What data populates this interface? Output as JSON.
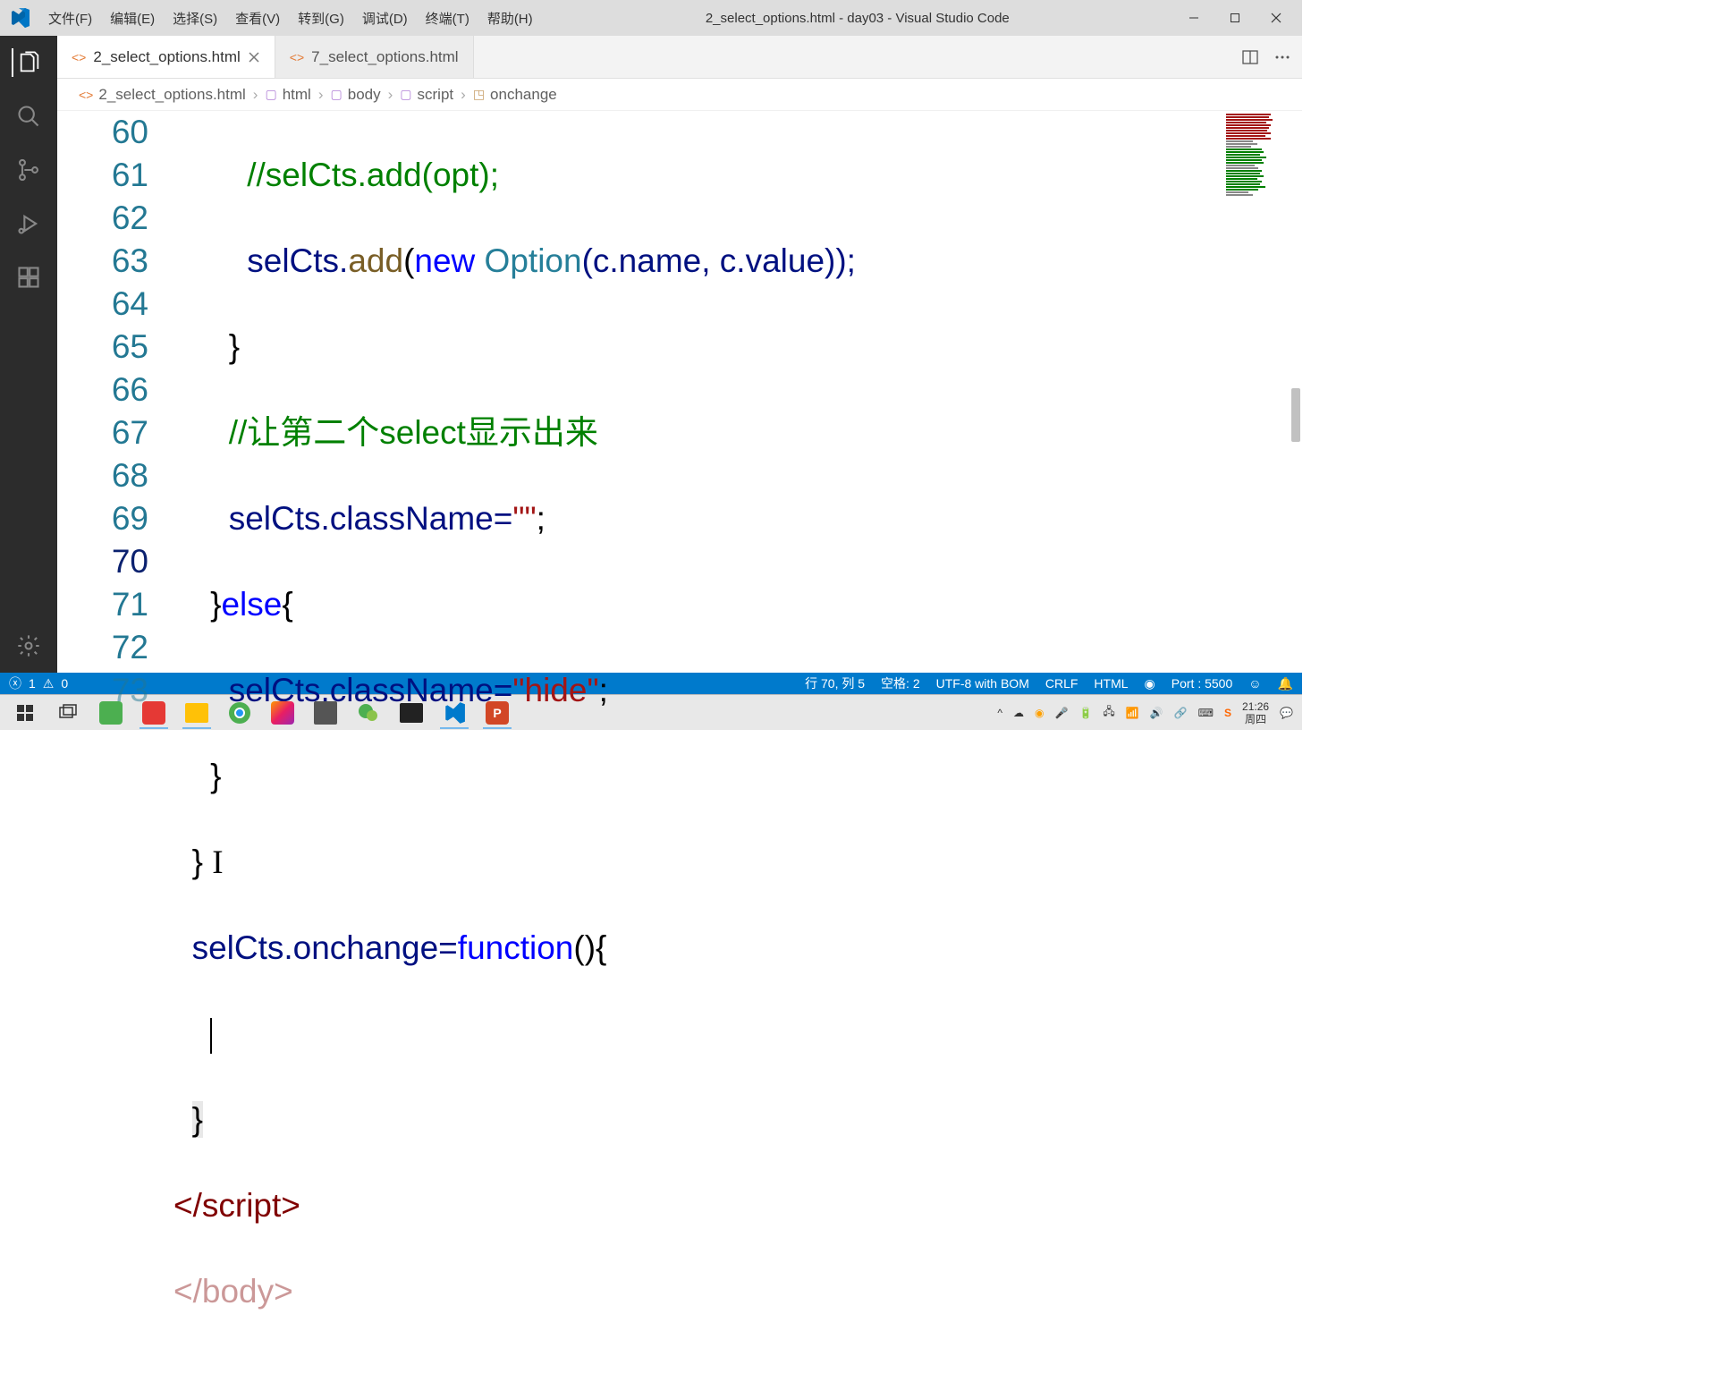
{
  "menu": {
    "file": "文件(F)",
    "edit": "编辑(E)",
    "selection": "选择(S)",
    "view": "查看(V)",
    "go": "转到(G)",
    "debug": "调试(D)",
    "terminal": "终端(T)",
    "help": "帮助(H)"
  },
  "window_title": "2_select_options.html - day03 - Visual Studio Code",
  "tabs": [
    {
      "label": "2_select_options.html",
      "active": true
    },
    {
      "label": "7_select_options.html",
      "active": false
    }
  ],
  "breadcrumb": {
    "file": "2_select_options.html",
    "p1": "html",
    "p2": "body",
    "p3": "script",
    "p4": "onchange"
  },
  "line_numbers": [
    "60",
    "61",
    "62",
    "63",
    "64",
    "65",
    "66",
    "67",
    "68",
    "69",
    "70",
    "71",
    "72",
    "73"
  ],
  "code": {
    "l60": "//selCts.add(opt);",
    "l61_pre": "selCts.",
    "l61_add": "add",
    "l61_mid": "(",
    "l61_new": "new",
    "l61_opt": " Option",
    "l61_args": "(c.name, c.value));",
    "l62": "}",
    "l63": "//让第二个select显示出来",
    "l64_pre": "selCts.className=",
    "l64_str": "\"\"",
    "l64_end": ";",
    "l65_brace": "}",
    "l65_else": "else",
    "l65_ob": "{",
    "l66_pre": "selCts.className=",
    "l66_str": "\"hide\"",
    "l66_end": ";",
    "l67": "}",
    "l68": "}",
    "l69_pre": "selCts.onchange=",
    "l69_func": "function",
    "l69_post": "(){",
    "l70": "",
    "l71": "}",
    "l72_open": "</",
    "l72_tag": "script",
    "l72_close": ">",
    "l73_open": "</",
    "l73_tag": "body",
    "l73_close": ">"
  },
  "statusbar": {
    "errors": "1",
    "warnings": "0",
    "line_col": "行 70, 列 5",
    "spaces": "空格: 2",
    "encoding": "UTF-8 with BOM",
    "eol": "CRLF",
    "lang": "HTML",
    "port": "Port : 5500"
  },
  "tray": {
    "time": "21:26",
    "date": "周四"
  }
}
